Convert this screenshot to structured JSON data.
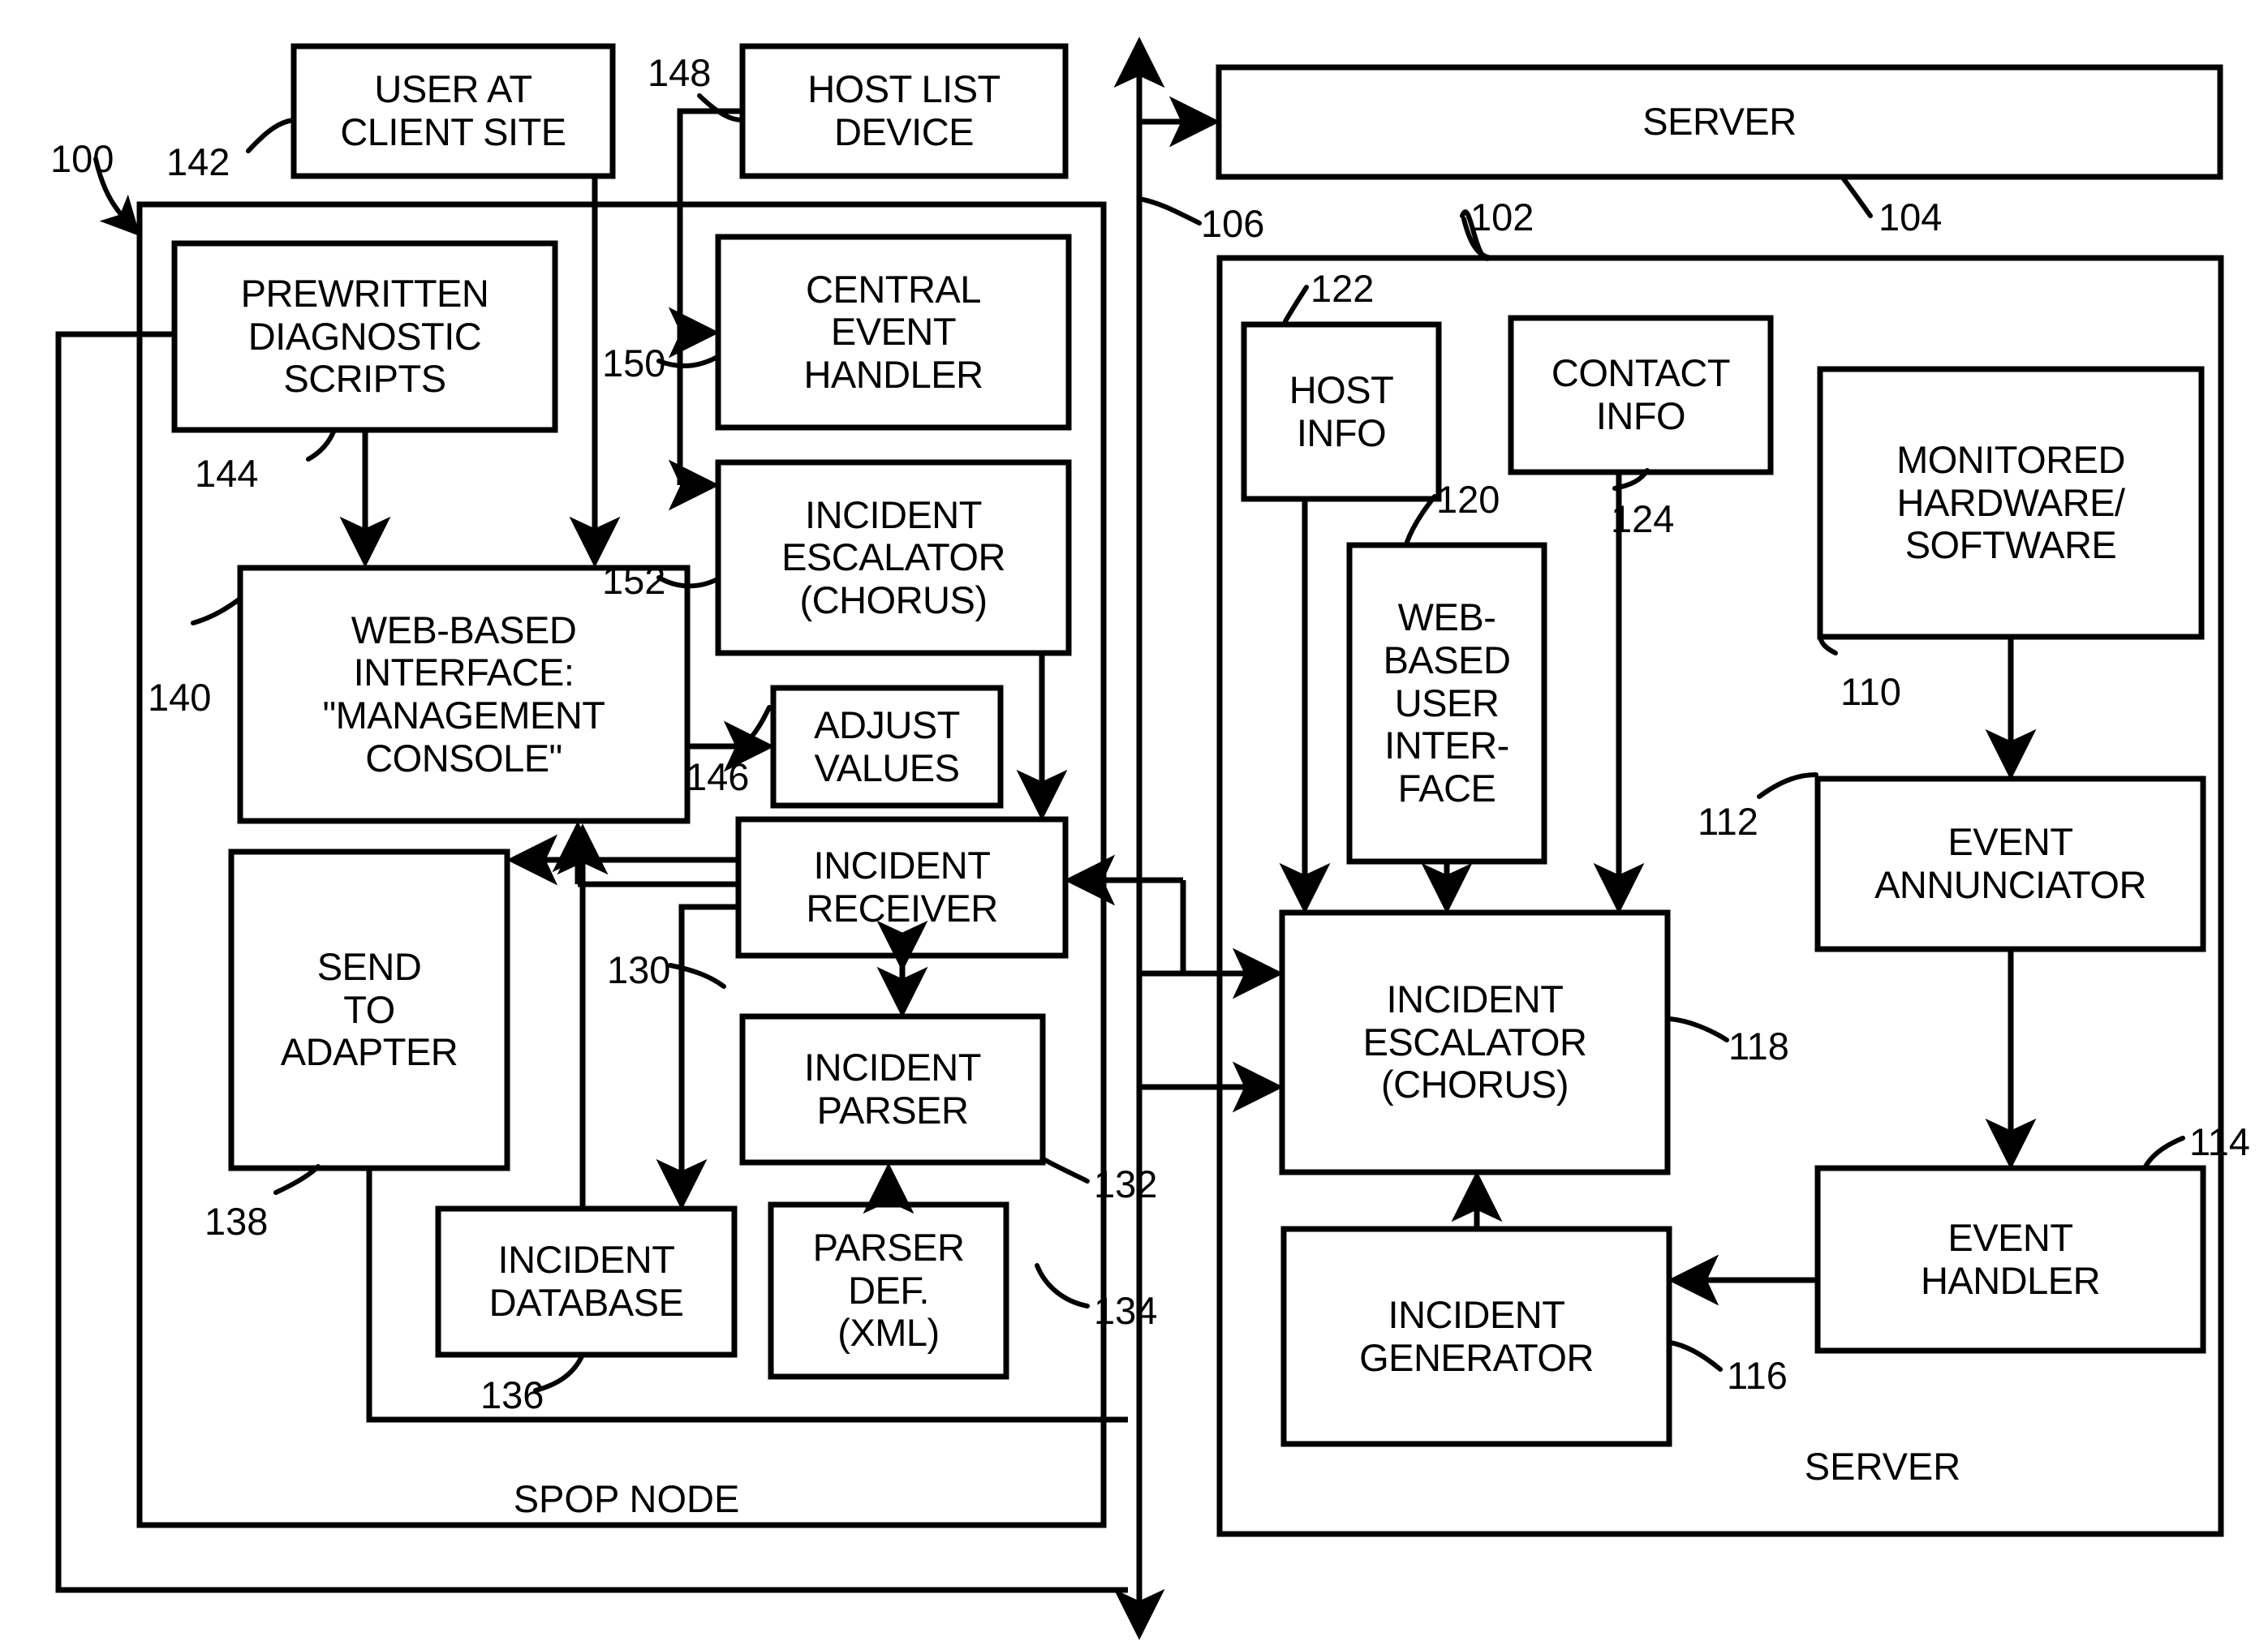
{
  "figure": {
    "type": "patent-block-diagram",
    "overall_ref": "100"
  },
  "boxes": [
    {
      "id": "user-at-client-site",
      "label": "USER AT\nCLIENT SITE",
      "ref": "142"
    },
    {
      "id": "host-list-device",
      "label": "HOST LIST\nDEVICE",
      "ref": "148"
    },
    {
      "id": "server-top",
      "label": "SERVER",
      "ref": "104"
    },
    {
      "id": "prewritten-diagnostic-scripts",
      "label": "PREWRITTEN\nDIAGNOSTIC\nSCRIPTS",
      "ref": "144"
    },
    {
      "id": "central-event-handler",
      "label": "CENTRAL\nEVENT\nHANDLER",
      "ref": "150"
    },
    {
      "id": "incident-escalator-chorus-left",
      "label": "INCIDENT\nESCALATOR\n(CHORUS)",
      "ref": "152"
    },
    {
      "id": "web-based-interface-management-console",
      "label": "WEB-BASED\nINTERFACE:\n\"MANAGEMENT\nCONSOLE\"",
      "ref": "140"
    },
    {
      "id": "adjust-values",
      "label": "ADJUST\nVALUES",
      "ref": "146"
    },
    {
      "id": "incident-receiver",
      "label": "INCIDENT\nRECEIVER",
      "ref": "130"
    },
    {
      "id": "send-to-adapter",
      "label": "SEND\nTO\nADAPTER",
      "ref": "138"
    },
    {
      "id": "incident-parser",
      "label": "INCIDENT\nPARSER",
      "ref": "132"
    },
    {
      "id": "incident-database",
      "label": "INCIDENT\nDATABASE",
      "ref": "136"
    },
    {
      "id": "parser-def-xml",
      "label": "PARSER\nDEF.\n(XML)",
      "ref": "134"
    },
    {
      "id": "host-info",
      "label": "HOST\nINFO",
      "ref": "122"
    },
    {
      "id": "contact-info",
      "label": "CONTACT\nINFO",
      "ref": "124"
    },
    {
      "id": "web-based-user-interface",
      "label": "WEB-\nBASED\nUSER\nINTER-\nFACE",
      "ref": "120"
    },
    {
      "id": "monitored-hardware-software",
      "label": "MONITORED\nHARDWARE/\nSOFTWARE",
      "ref": "110"
    },
    {
      "id": "event-annunciator",
      "label": "EVENT\nANNUNCIATOR",
      "ref": "112"
    },
    {
      "id": "event-handler",
      "label": "EVENT\nHANDLER",
      "ref": "114"
    },
    {
      "id": "incident-escalator-chorus-right",
      "label": "INCIDENT\nESCALATOR\n(CHORUS)",
      "ref": "118"
    },
    {
      "id": "incident-generator",
      "label": "INCIDENT\nGENERATOR",
      "ref": "116"
    }
  ],
  "containers": [
    {
      "id": "spop-node",
      "label": "SPOP NODE",
      "ref": "100"
    },
    {
      "id": "server-right",
      "label": "SERVER",
      "ref": "102"
    }
  ],
  "ref_numbers": [
    "100",
    "102",
    "104",
    "106",
    "110",
    "112",
    "114",
    "116",
    "118",
    "120",
    "122",
    "124",
    "130",
    "132",
    "134",
    "136",
    "138",
    "140",
    "142",
    "144",
    "146",
    "148",
    "150",
    "152"
  ],
  "network_link": {
    "id": "network-bus",
    "ref": "106"
  },
  "colors": {
    "ink": "#000000",
    "paper": "#ffffff"
  }
}
